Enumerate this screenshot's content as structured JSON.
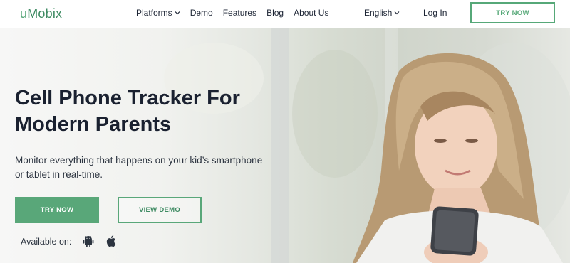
{
  "header": {
    "logo": {
      "mark": "u",
      "text": "Mobix"
    },
    "nav": [
      {
        "label": "Platforms",
        "has_dropdown": true
      },
      {
        "label": "Demo"
      },
      {
        "label": "Features"
      },
      {
        "label": "Blog"
      },
      {
        "label": "About Us"
      }
    ],
    "language": "English",
    "login": "Log In",
    "try_now": "TRY NOW"
  },
  "hero": {
    "title_line1": "Cell Phone Tracker For",
    "title_line2": "Modern Parents",
    "subtitle_line1": "Monitor everything that happens on your kid’s smartphone",
    "subtitle_line2": "or tablet in real-time.",
    "try_button": "TRY NOW",
    "demo_button": "VIEW DEMO",
    "available_label": "Available on:",
    "platform_icons": [
      "android-icon",
      "apple-icon"
    ]
  },
  "colors": {
    "accent": "#59a779",
    "text_dark": "#1a2130"
  }
}
